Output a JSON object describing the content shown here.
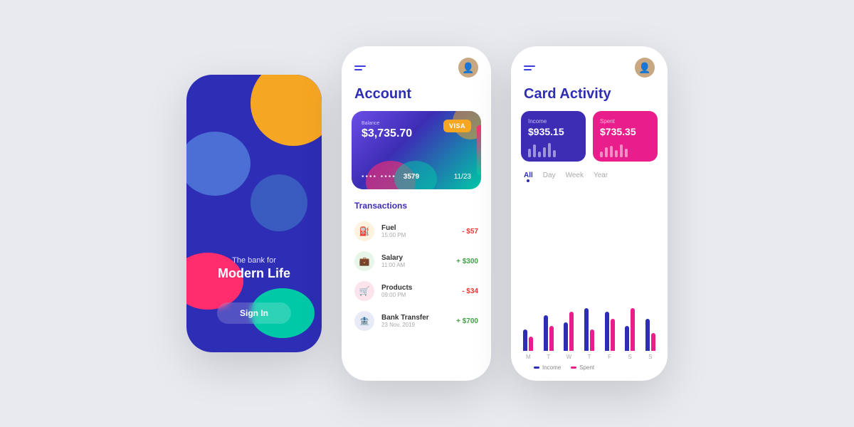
{
  "app": {
    "bg_color": "#e8eaf0"
  },
  "phone1": {
    "tagline": "The bank for",
    "title": "Modern Life",
    "signin_label": "Sign In"
  },
  "phone2": {
    "page_title": "Account",
    "card": {
      "balance_label": "Balance",
      "balance": "$3,735.70",
      "brand": "VISA",
      "dots": "••••  ••••",
      "last4": "3579",
      "expiry": "11/23"
    },
    "transactions_title": "Transactions",
    "transactions": [
      {
        "name": "Fuel",
        "time": "15:00 PM",
        "amount": "- $57",
        "type": "negative",
        "icon": "⛽",
        "icon_class": "transaction-icon-fuel"
      },
      {
        "name": "Salary",
        "time": "11:00 AM",
        "amount": "+ $300",
        "type": "positive",
        "icon": "💼",
        "icon_class": "transaction-icon-salary"
      },
      {
        "name": "Products",
        "time": "09:00 PM",
        "amount": "- $34",
        "type": "negative",
        "icon": "🛒",
        "icon_class": "transaction-icon-products"
      },
      {
        "name": "Bank Transfer",
        "time": "23 Nov, 2019",
        "amount": "+ $700",
        "type": "positive",
        "icon": "🏦",
        "icon_class": "transaction-icon-bank"
      }
    ]
  },
  "phone3": {
    "page_title": "Card Activity",
    "income": {
      "label": "Income",
      "value": "$935.15",
      "bars": [
        12,
        18,
        8,
        14,
        20,
        10
      ]
    },
    "spent": {
      "label": "Spent",
      "value": "$735.35",
      "bars": [
        8,
        14,
        16,
        10,
        18,
        12
      ]
    },
    "periods": [
      "All",
      "Day",
      "Week",
      "Year"
    ],
    "active_period": "All",
    "chart": {
      "days": [
        "M",
        "T",
        "W",
        "T",
        "F",
        "S",
        "S"
      ],
      "income_heights": [
        30,
        50,
        40,
        60,
        55,
        35,
        45
      ],
      "spent_heights": [
        20,
        35,
        55,
        30,
        45,
        60,
        25
      ]
    },
    "legend": {
      "income": "Income",
      "spent": "Spent"
    }
  }
}
